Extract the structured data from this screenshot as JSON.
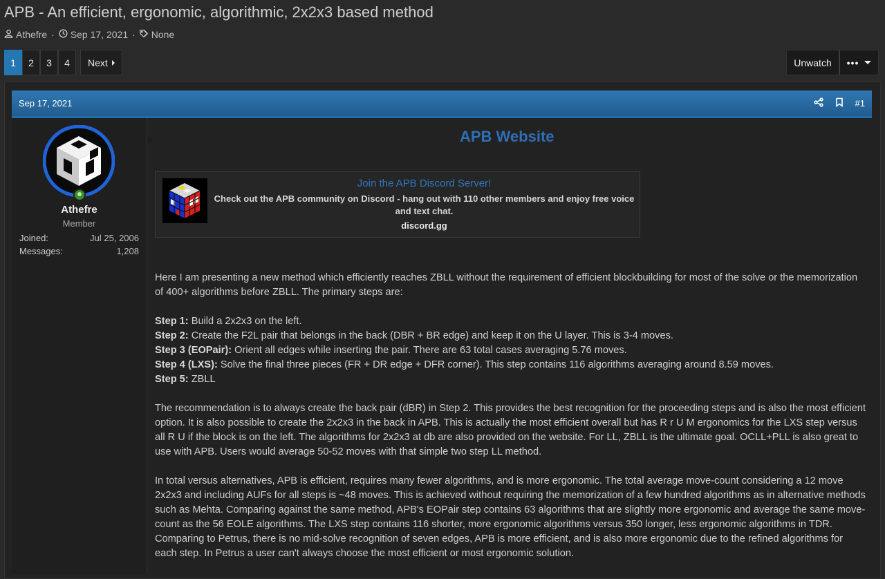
{
  "thread": {
    "title": "APB - An efficient, ergonomic, algorithmic, 2x2x3 based method",
    "author": "Athefre",
    "date": "Sep 17, 2021",
    "tags": "None"
  },
  "pagination": {
    "pages": [
      "1",
      "2",
      "3",
      "4"
    ],
    "current": "1",
    "next_label": "Next"
  },
  "actions": {
    "unwatch_label": "Unwatch",
    "more_label": "•••"
  },
  "post": {
    "date": "Sep 17, 2021",
    "number": "#1",
    "user": {
      "name": "Athefre",
      "title": "Member",
      "joined_label": "Joined:",
      "joined_value": "Jul 25, 2006",
      "messages_label": "Messages:",
      "messages_value": "1,208"
    },
    "website_link": "APB Website",
    "embed": {
      "title": "Join the APB Discord Server!",
      "description": "Check out the APB community on Discord - hang out with 110 other members and enjoy free voice and text chat.",
      "site": "discord.gg"
    },
    "intro": "Here I am presenting a new method which efficiently reaches ZBLL without the requirement of efficient blockbuilding for most of the solve or the memorization of 400+ algorithms before ZBLL. The primary steps are:",
    "steps": [
      {
        "label": "Step 1:",
        "text": " Build a 2x2x3 on the left."
      },
      {
        "label": "Step 2:",
        "text": " Create the F2L pair that belongs in the back (DBR + BR edge) and keep it on the U layer. This is 3-4 moves."
      },
      {
        "label": "Step 3 (EOPair):",
        "text": " Orient all edges while inserting the pair. There are 63 total cases averaging 5.76 moves."
      },
      {
        "label": "Step 4 (LXS):",
        "text": " Solve the final three pieces (FR + DR edge + DFR corner). This step contains 116 algorithms averaging around 8.59 moves."
      },
      {
        "label": "Step 5:",
        "text": " ZBLL"
      }
    ],
    "paragraph2": "The recommendation is to always create the back pair (dBR) in Step 2. This provides the best recognition for the proceeding steps and is also the most efficient option. It is also possible to create the 2x2x3 in the back in APB. This is actually the most efficient overall but has R r U M ergonomics for the LXS step versus all R U if the block is on the left. The algorithms for 2x2x3 at db are also provided on the website. For LL, ZBLL is the ultimate goal. OCLL+PLL is also great to use with APB. Users would average 50-52 moves with that simple two step LL method.",
    "paragraph3": "In total versus alternatives, APB is efficient, requires many fewer algorithms, and is more ergonomic. The total average move-count considering a 12 move 2x2x3 and including AUFs for all steps is ~48 moves. This is achieved without requiring the memorization of a few hundred algorithms as in alternative methods such as Mehta. Comparing against the same method, APB's EOPair step contains 63 algorithms that are slightly more ergonomic and average the same move-count as the 56 EOLE algorithms. The LXS step contains 116 shorter, more ergonomic algorithms versus 350 longer, less ergonomic algorithms in TDR. Comparing to Petrus, there is no mid-solve recognition of seven edges, APB is more efficient, and is also more ergonomic due to the refined algorithms for each step. In Petrus a user can't always choose the most efficient or most ergonomic solution."
  },
  "colors": {
    "accent": "#2577b1",
    "link": "#2f6fb5",
    "online": "#3c8e28"
  }
}
